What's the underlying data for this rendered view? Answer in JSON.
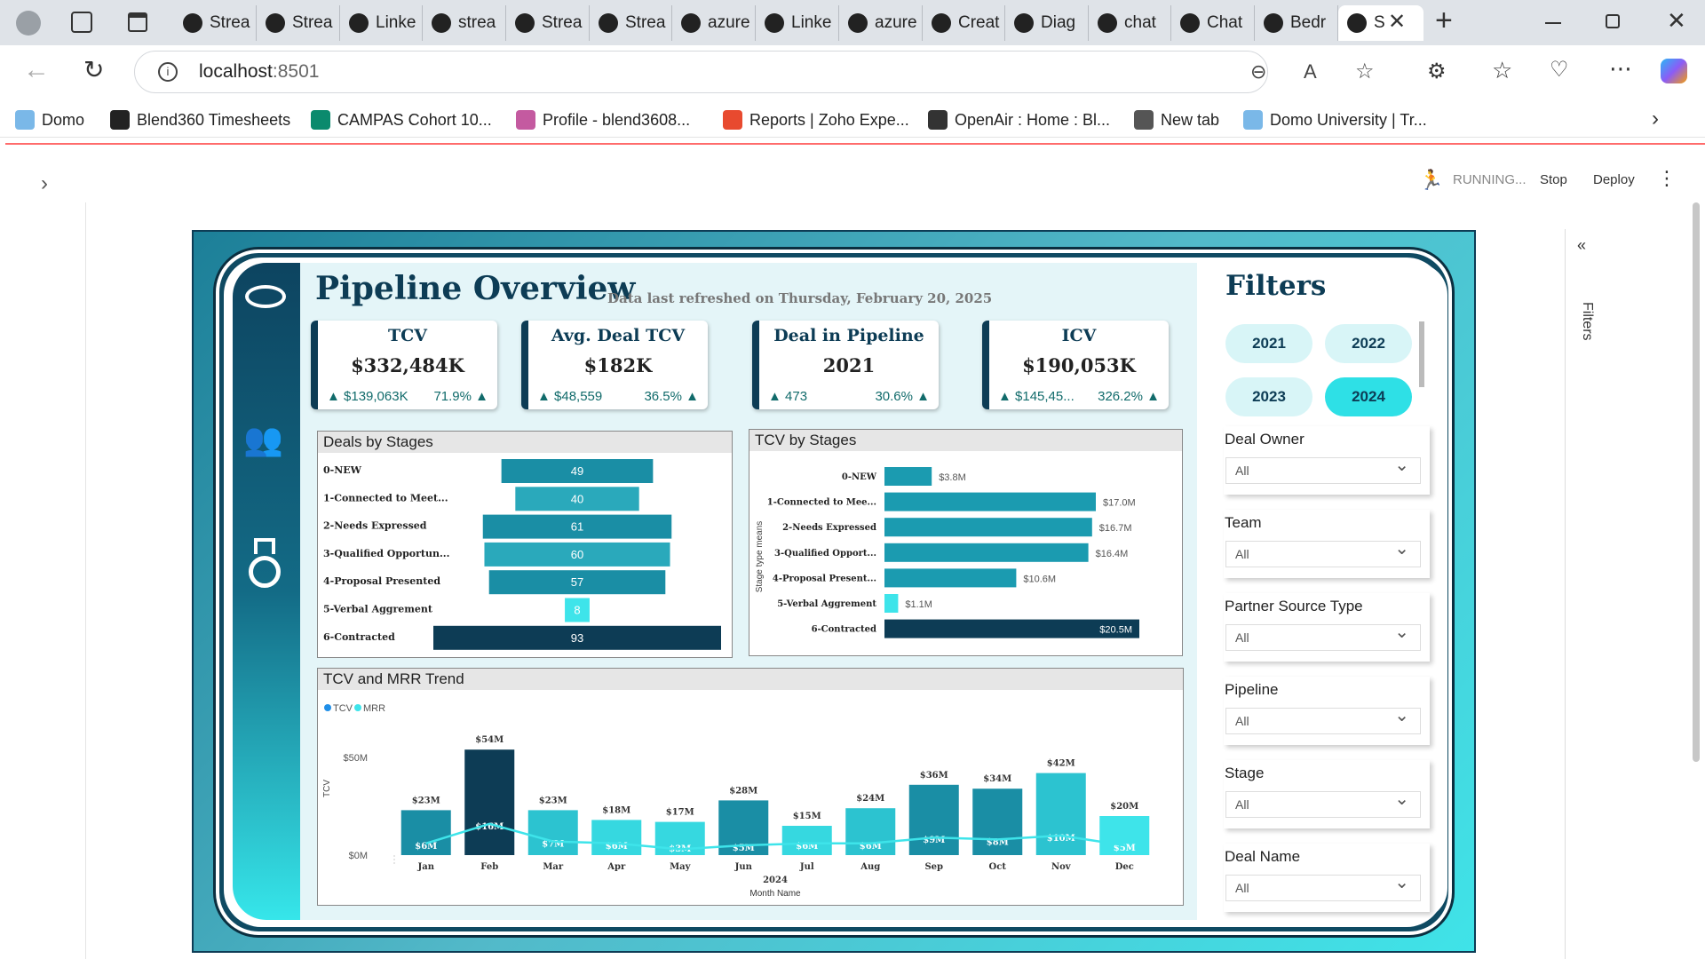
{
  "browser": {
    "tabs": [
      {
        "label": "Strea"
      },
      {
        "label": "Strea"
      },
      {
        "label": "Linke"
      },
      {
        "label": "strea"
      },
      {
        "label": "Strea"
      },
      {
        "label": "Strea"
      },
      {
        "label": "azure"
      },
      {
        "label": "Linke"
      },
      {
        "label": "azure"
      },
      {
        "label": "Creat"
      },
      {
        "label": "Diag"
      },
      {
        "label": "chat"
      },
      {
        "label": "Chat"
      },
      {
        "label": "Bedr"
      },
      {
        "label": "S"
      }
    ],
    "url_host": "localhost",
    "url_port": ":8501",
    "bookmarks": [
      {
        "label": "Domo"
      },
      {
        "label": "Blend360 Timesheets"
      },
      {
        "label": "CAMPAS Cohort 10..."
      },
      {
        "label": "Profile - blend3608..."
      },
      {
        "label": "Reports | Zoho Expe..."
      },
      {
        "label": "OpenAir : Home : Bl..."
      },
      {
        "label": "New tab"
      },
      {
        "label": "Domo University | Tr..."
      }
    ]
  },
  "streamlit": {
    "status": "RUNNING...",
    "stop": "Stop",
    "deploy": "Deploy"
  },
  "report": {
    "title": "Pipeline Overview",
    "refreshed": "Data last refreshed on Thursday, February 20, 2025",
    "side_filters_label": "Filters",
    "kpis": [
      {
        "title": "TCV",
        "value": "$332,484K",
        "delta": "$139,063K",
        "pct": "71.9%"
      },
      {
        "title": "Avg. Deal TCV",
        "value": "$182K",
        "delta": "$48,559",
        "pct": "36.5%"
      },
      {
        "title": "Deal in Pipeline",
        "value": "2021",
        "delta": "473",
        "pct": "30.6%"
      },
      {
        "title": "ICV",
        "value": "$190,053K",
        "delta": "$145,45...",
        "pct": "326.2%"
      }
    ],
    "filters": {
      "title": "Filters",
      "years": [
        "2021",
        "2022",
        "2023",
        "2024"
      ],
      "selected_year": "2024",
      "fields": [
        {
          "label": "Deal Owner",
          "value": "All"
        },
        {
          "label": "Team",
          "value": "All"
        },
        {
          "label": "Partner Source Type",
          "value": "All"
        },
        {
          "label": "Pipeline",
          "value": "All"
        },
        {
          "label": "Stage",
          "value": "All"
        },
        {
          "label": "Deal Name",
          "value": "All"
        }
      ]
    },
    "colors": {
      "dark": "#0d3c55",
      "teal": "#1b9bb0",
      "mid": "#21b0c0",
      "light": "#3ee4ea"
    }
  },
  "chart_data": [
    {
      "type": "bar",
      "title": "Deals by Stages",
      "categories": [
        "0-NEW",
        "1-Connected to Meet...",
        "2-Needs Expressed",
        "3-Qualified Opportun...",
        "4-Proposal Presented",
        "5-Verbal Aggrement",
        "6-Contracted"
      ],
      "values": [
        49,
        40,
        61,
        60,
        57,
        8,
        93
      ]
    },
    {
      "type": "bar",
      "title": "TCV by Stages",
      "ylabel": "Stage type means",
      "categories": [
        "0-NEW",
        "1-Connected to Mee...",
        "2-Needs Expressed",
        "3-Qualified Opport...",
        "4-Proposal Present...",
        "5-Verbal Aggrement",
        "6-Contracted"
      ],
      "values": [
        3.8,
        17.0,
        16.7,
        16.4,
        10.6,
        1.1,
        20.5
      ],
      "labels": [
        "$3.8M",
        "$17.0M",
        "$16.7M",
        "$16.4M",
        "$10.6M",
        "$1.1M",
        "$20.5M"
      ]
    },
    {
      "type": "bar",
      "title": "TCV and MRR Trend",
      "xlabel": "Month Name",
      "ylabel": "TCV",
      "year_label": "2024",
      "categories": [
        "Jan",
        "Feb",
        "Mar",
        "Apr",
        "May",
        "Jun",
        "Jul",
        "Aug",
        "Sep",
        "Oct",
        "Nov",
        "Dec"
      ],
      "yticks": [
        "$50M",
        "$0M"
      ],
      "ylim": [
        0,
        60
      ],
      "series": [
        {
          "name": "TCV",
          "values": [
            23,
            54,
            23,
            18,
            17,
            28,
            15,
            24,
            36,
            34,
            42,
            20
          ],
          "labels": [
            "$23M",
            "$54M",
            "$23M",
            "$18M",
            "$17M",
            "$28M",
            "$15M",
            "$24M",
            "$36M",
            "$34M",
            "$42M",
            "$20M"
          ]
        },
        {
          "name": "MRR",
          "values": [
            6,
            16,
            7,
            6,
            3,
            5,
            6,
            6,
            9,
            8,
            10,
            5
          ],
          "labels": [
            "$6M",
            "$16M",
            "$7M",
            "$6M",
            "$3M",
            "$5M",
            "$6M",
            "$6M",
            "$9M",
            "$8M",
            "$10M",
            "$5M"
          ]
        }
      ]
    }
  ]
}
